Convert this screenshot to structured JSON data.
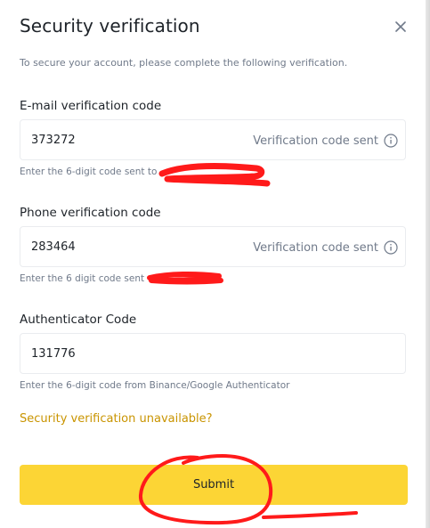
{
  "dialog": {
    "title": "Security verification",
    "subtitle": "To secure your account, please complete the following verification."
  },
  "email": {
    "label": "E-mail verification code",
    "value": "373272",
    "status": "Verification code sent",
    "help": "Enter the 6-digit code sent to"
  },
  "phone": {
    "label": "Phone verification code",
    "value": "283464",
    "status": "Verification code sent",
    "help": "Enter the 6 digit code sent"
  },
  "authenticator": {
    "label": "Authenticator Code",
    "value": "131776",
    "help": "Enter the 6-digit code from Binance/Google Authenticator"
  },
  "links": {
    "unavailable": "Security verification unavailable?"
  },
  "actions": {
    "submit": "Submit"
  },
  "icons": {
    "close": "close-icon",
    "info": "info-icon"
  },
  "colors": {
    "accent_yellow": "#fcd535",
    "link_gold": "#c99400",
    "annotation_red": "#ff1a1a"
  }
}
